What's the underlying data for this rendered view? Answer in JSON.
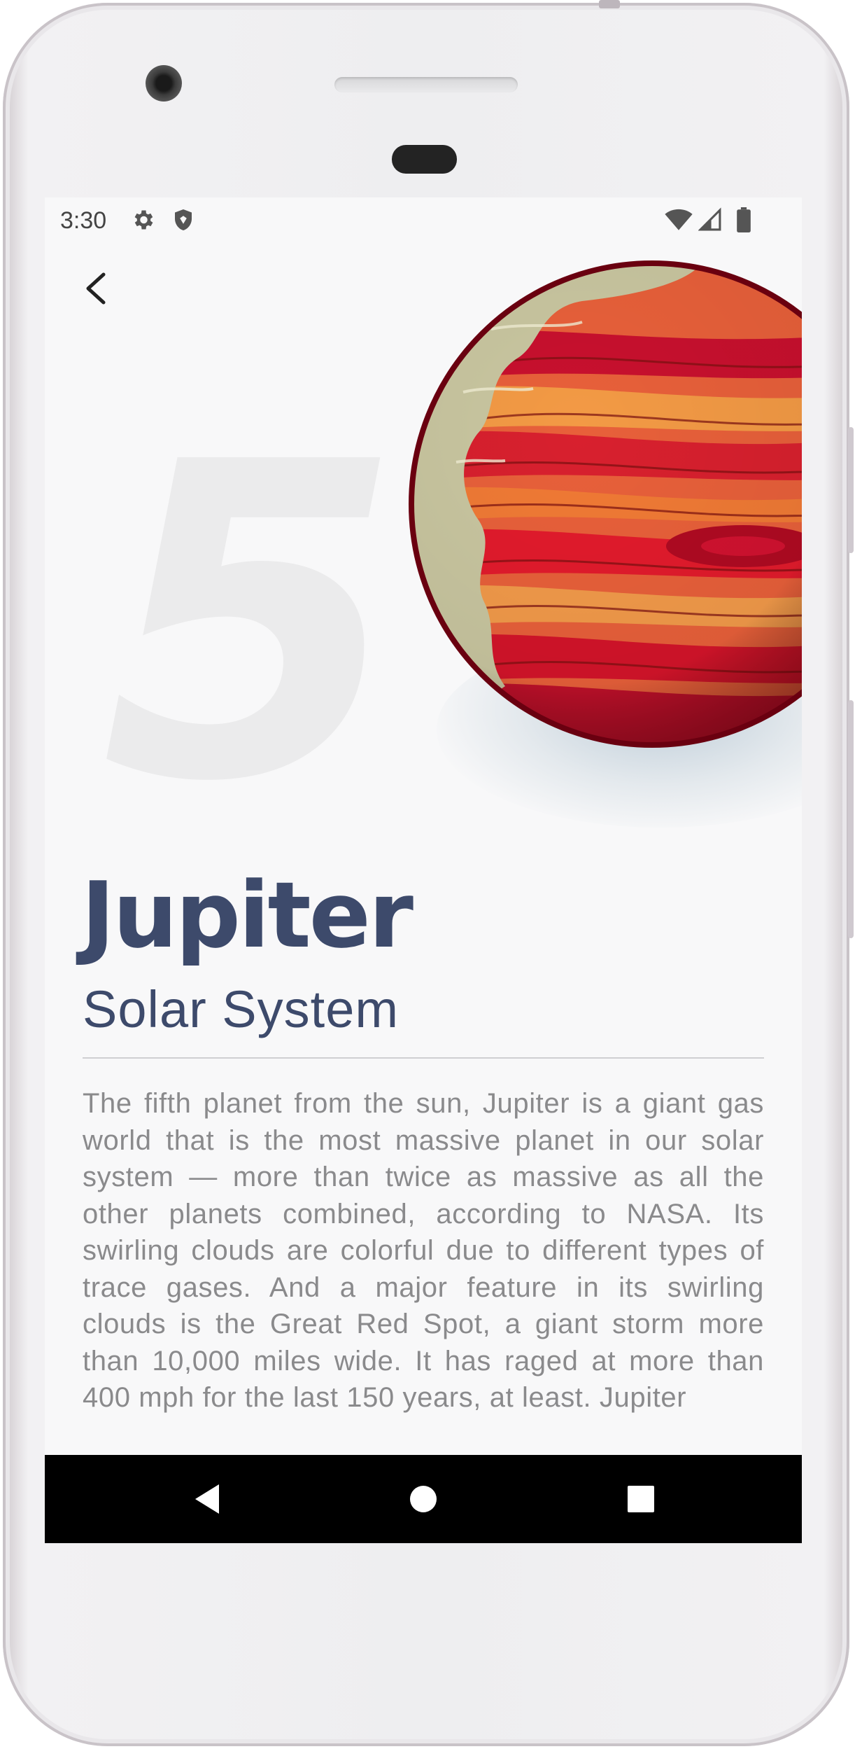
{
  "status_bar": {
    "time": "3:30",
    "left_icons": [
      "gear-icon",
      "shield-icon"
    ],
    "right_icons": [
      "wifi-icon",
      "signal-icon",
      "battery-icon"
    ]
  },
  "toolbar": {
    "back_icon": "chevron-left-icon"
  },
  "planet": {
    "number": "5",
    "name": "Jupiter",
    "subtitle": "Solar System",
    "description": "The fifth planet from the sun, Jupiter is a giant gas world that is the most massive planet in our solar system — more than twice as massive as all the other planets combined, according to NASA. Its swirling clouds are colorful due to different types of trace gases. And a major feature in its swirling clouds is the Great Red Spot, a giant storm more than 10,000 miles wide. It has raged at more than 400 mph for the last 150 years, at least. Jupiter",
    "colors": {
      "title": "#3d4a6b",
      "body_text": "#8a8a8c",
      "number": "#ebebec",
      "planet_red": "#c8102e",
      "planet_orange": "#f06a2a",
      "planet_cream": "#c9c6a0"
    }
  },
  "nav_bar": {
    "back": "triangle-back-icon",
    "home": "circle-home-icon",
    "recents": "square-recents-icon"
  }
}
